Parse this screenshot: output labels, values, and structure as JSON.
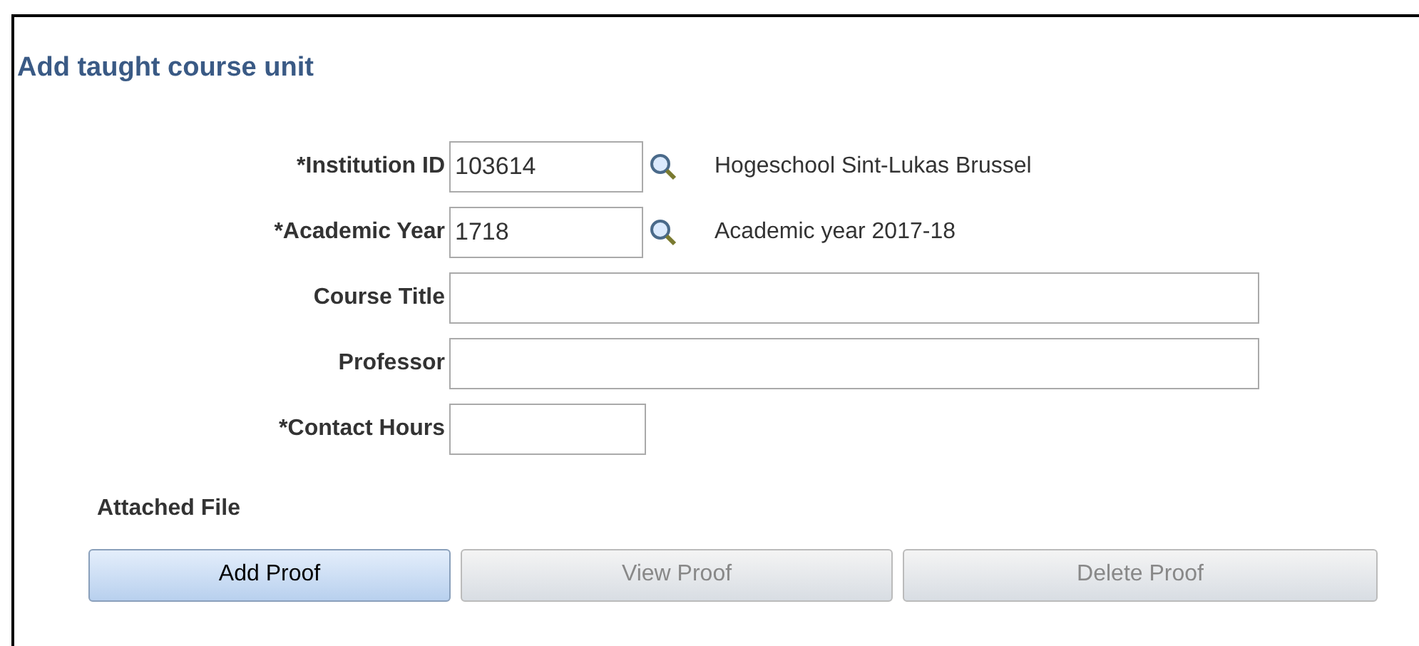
{
  "title": "Add taught course unit",
  "fields": [
    {
      "kind": "lookup",
      "label": "*Institution ID",
      "value": "103614",
      "description": "Hogeschool Sint-Lukas Brussel"
    },
    {
      "kind": "lookup",
      "label": "*Academic Year",
      "value": "1718",
      "description": "Academic year 2017-18"
    },
    {
      "kind": "wide",
      "label": "Course Title"
    },
    {
      "kind": "wide",
      "label": "Professor"
    },
    {
      "kind": "short",
      "label": "*Contact Hours"
    }
  ],
  "section": "Attached File",
  "buttons": [
    {
      "label": "Add Proof",
      "disabled": false
    },
    {
      "label": "View Proof",
      "disabled": true
    },
    {
      "label": "Delete Proof",
      "disabled": true
    }
  ]
}
